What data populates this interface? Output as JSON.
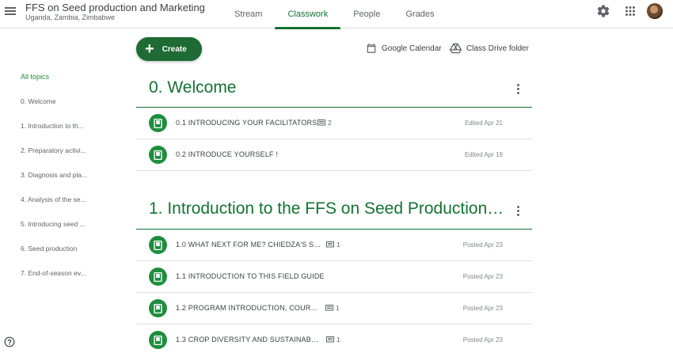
{
  "header": {
    "class_title": "FFS on Seed production and Marketing",
    "class_subtitle": "Uganda, Zambia, Zimbabwe",
    "tabs": [
      {
        "label": "Stream",
        "active": false
      },
      {
        "label": "Classwork",
        "active": true
      },
      {
        "label": "People",
        "active": false
      },
      {
        "label": "Grades",
        "active": false
      }
    ],
    "icons": [
      "menu-icon",
      "gear-icon",
      "apps-grid-icon",
      "avatar"
    ]
  },
  "toolbar": {
    "create_label": "Create",
    "calendar_label": "Google Calendar",
    "drive_label": "Class Drive folder"
  },
  "topics": {
    "items": [
      {
        "label": "All topics",
        "active": true
      },
      {
        "label": "0. Welcome",
        "active": false
      },
      {
        "label": "1. Introduction to th...",
        "active": false
      },
      {
        "label": "2. Preparatory activi...",
        "active": false
      },
      {
        "label": "3. Diagnosis and pla...",
        "active": false
      },
      {
        "label": "4. Analysis of the se...",
        "active": false
      },
      {
        "label": "5. Introducing seed ...",
        "active": false
      },
      {
        "label": "6. Seed production",
        "active": false
      },
      {
        "label": "7. End-of-season ev...",
        "active": false
      }
    ]
  },
  "sections": [
    {
      "title": "0. Welcome",
      "items": [
        {
          "title": "0.1 INTRODUCING YOUR FACILITATORS",
          "comments": "2",
          "date": "Edited Apr 21"
        },
        {
          "title": "0.2 INTRODUCE YOURSELF !",
          "comments": "",
          "date": "Edited Apr 19"
        }
      ]
    },
    {
      "title": "1. Introduction to the FFS on Seed Production ...",
      "items": [
        {
          "title": "1.0 WHAT NEXT FOR ME? CHIEDZA'S ST...",
          "comments": "1",
          "date": "Posted Apr 23"
        },
        {
          "title": "1.1 INTRODUCTION TO THIS FIELD GUIDE",
          "comments": "",
          "date": "Posted Apr 23"
        },
        {
          "title": "1.2 PROGRAM INTRODUCTION, COURS...",
          "comments": "1",
          "date": "Posted Apr 23"
        },
        {
          "title": "1.3 CROP DIVERSITY AND SUSTAINABLE ...",
          "comments": "1",
          "date": "Posted Apr 23"
        }
      ]
    }
  ],
  "colors": {
    "accent": "#137333",
    "create_button": "#1e6b33",
    "material_icon": "#1e8e3e"
  }
}
